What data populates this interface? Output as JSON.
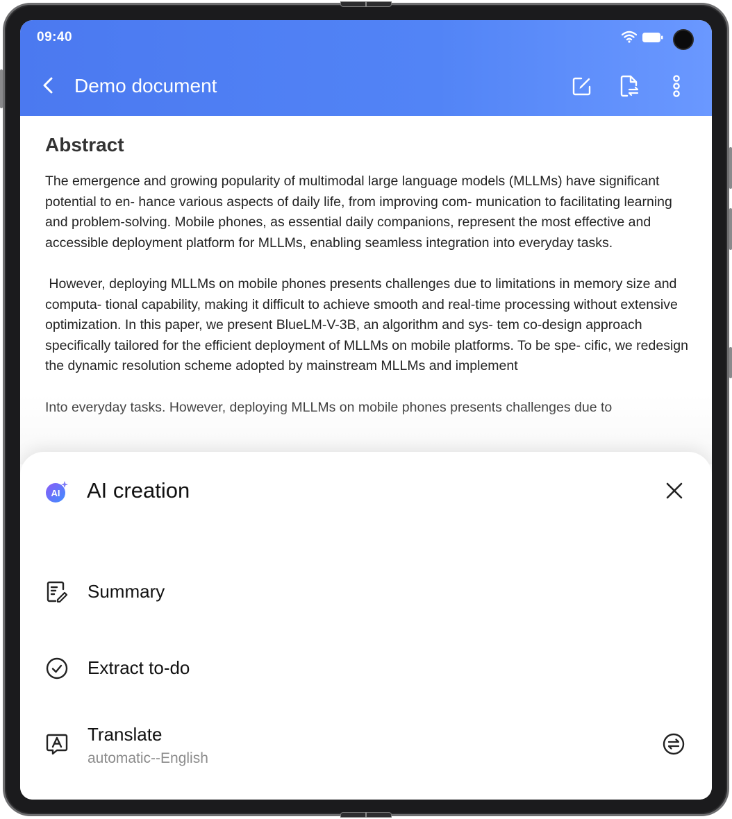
{
  "status_bar": {
    "time": "09:40"
  },
  "header": {
    "title": "Demo document",
    "icons": [
      "back-icon",
      "edit-icon",
      "file-convert-icon",
      "more-icon"
    ]
  },
  "document": {
    "heading": "Abstract",
    "paragraphs": [
      "The emergence and growing popularity of multimodal large language models (MLLMs) have significant potential to en- hance various aspects of daily life, from improving com- munication to facilitating learning and problem-solving. Mobile phones, as essential daily companions, represent the most effective and accessible deployment platform for MLLMs, enabling seamless integration into everyday tasks.",
      " However, deploying MLLMs on mobile phones presents challenges due to limitations in memory size and computa- tional capability, making it difficult to achieve smooth and real-time processing without extensive optimization. In this paper, we present BlueLM-V-3B, an algorithm and sys- tem co-design approach specifically tailored for the efficient deployment of MLLMs on mobile platforms. To be spe- cific, we redesign the dynamic resolution scheme adopted by mainstream MLLMs and implement",
      "Into everyday tasks. However, deploying MLLMs on mobile phones presents challenges due to"
    ]
  },
  "sheet": {
    "title": "AI creation",
    "badge_text": "AI",
    "options": [
      {
        "label": "Summary",
        "icon": "summary-icon"
      },
      {
        "label": "Extract to-do",
        "icon": "check-circle-icon"
      },
      {
        "label": "Translate",
        "sublabel": "automatic--English",
        "icon": "translate-icon"
      }
    ]
  },
  "colors": {
    "header_start": "#4b79f0",
    "header_end": "#6a98ff",
    "ai_badge_start": "#7b5cf5",
    "ai_badge_end": "#4fa6ff"
  }
}
